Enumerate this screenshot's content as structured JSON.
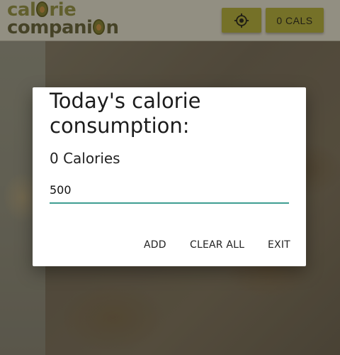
{
  "header": {
    "logo_line1_prefix": "cal",
    "logo_line1_suffix": "rie",
    "logo_line2_prefix": "compani",
    "logo_line2_suffix": "n",
    "cals_button_label": "0 CALS"
  },
  "dialog": {
    "title": "Today's calorie consumption:",
    "count_text": "0 Calories",
    "input_value": "500",
    "actions": {
      "add_label": "ADD",
      "clear_label": "CLEAR ALL",
      "exit_label": "EXIT"
    }
  },
  "colors": {
    "accent": "#adaa31",
    "input_underline": "#3f9e92",
    "header_bg": "#dfdccb"
  },
  "icons": {
    "locate": "crosshair-icon",
    "logo": "avocado-icon"
  }
}
